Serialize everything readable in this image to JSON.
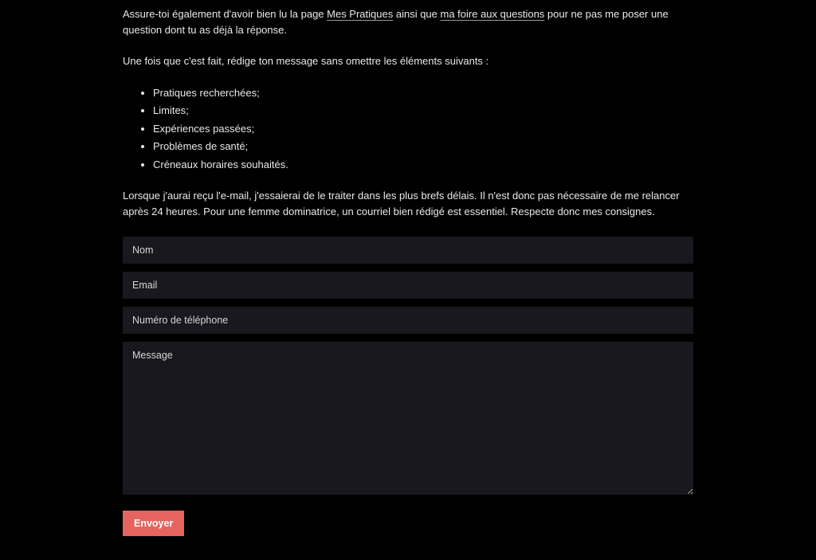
{
  "intro": {
    "p1_before": "Assure-toi également d'avoir bien lu la page ",
    "link1": "Mes Pratiques",
    "p1_mid": " ainsi que ",
    "link2": "ma foire aux questions",
    "p1_after": " pour ne pas me poser une question dont tu as déjà la réponse.",
    "p2": "Une fois que c'est fait, rédige ton message sans omettre les éléments suivants :"
  },
  "bullets": {
    "b1": "Pratiques recherchées;",
    "b2": "Limites;",
    "b3": "Expériences passées;",
    "b4": "Problèmes de santé;",
    "b5": "Créneaux horaires souhaités."
  },
  "outro": "Lorsque j'aurai reçu l'e-mail, j'essaierai de le traiter dans les plus brefs délais. Il n'est donc pas nécessaire de me relancer après 24 heures. Pour une femme dominatrice, un courriel bien rédigé est essentiel. Respecte donc mes consignes.",
  "form": {
    "name_placeholder": "Nom",
    "email_placeholder": "Email",
    "phone_placeholder": "Numéro de téléphone",
    "message_placeholder": "Message",
    "submit_label": "Envoyer"
  }
}
